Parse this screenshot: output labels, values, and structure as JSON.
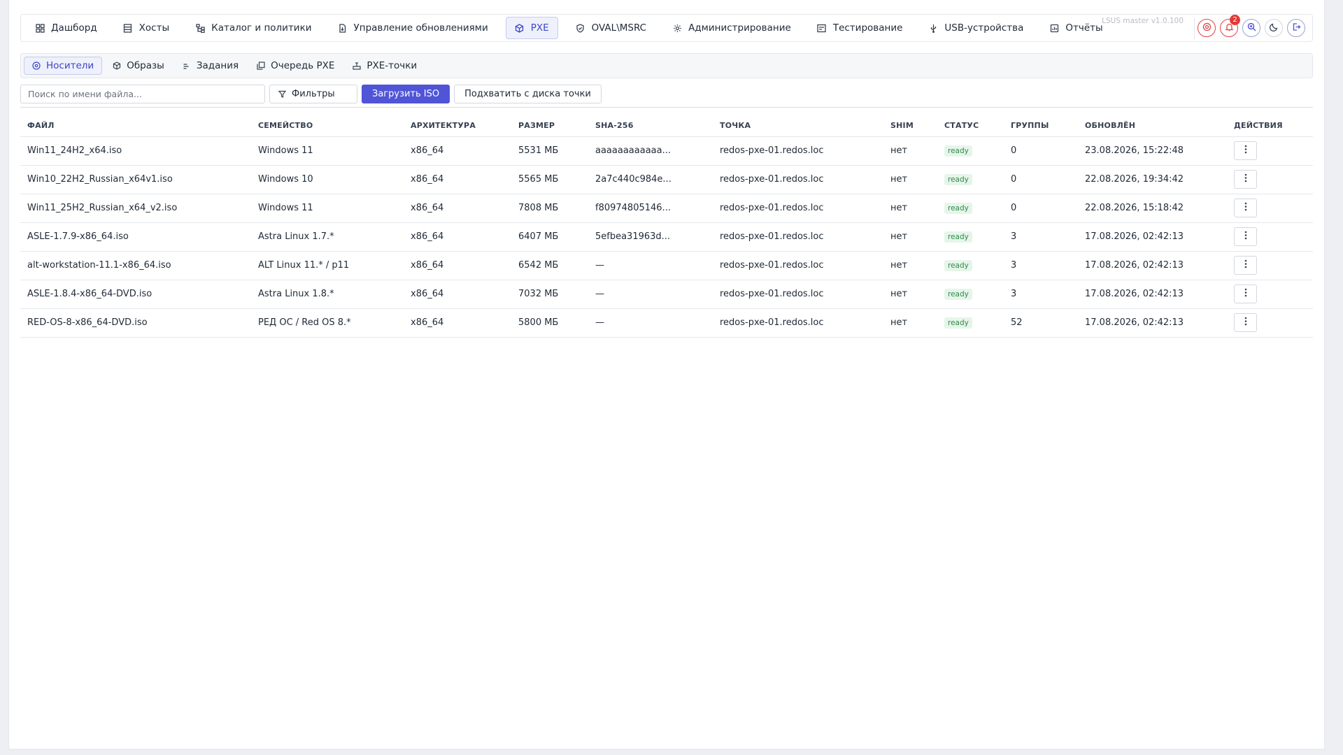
{
  "topnav": {
    "items": [
      {
        "label": "Дашборд",
        "icon": "dashboard-icon"
      },
      {
        "label": "Хосты",
        "icon": "server-icon"
      },
      {
        "label": "Каталог и политики",
        "icon": "hierarchy-icon"
      },
      {
        "label": "Управление обновлениями",
        "icon": "update-file-icon"
      },
      {
        "label": "PXE",
        "icon": "cube-icon"
      },
      {
        "label": "OVAL\\MSRC",
        "icon": "shield-check-icon"
      },
      {
        "label": "Администрирование",
        "icon": "gear-icon"
      },
      {
        "label": "Тестирование",
        "icon": "checklist-icon"
      },
      {
        "label": "USB-устройства",
        "icon": "usb-icon"
      },
      {
        "label": "Отчёты",
        "icon": "report-icon"
      }
    ],
    "active_index": 4,
    "version": "LSUS master v1.0.100",
    "notification_count": "2",
    "colors": {
      "accent": "#4f55d6",
      "alert": "#e04444"
    }
  },
  "subnav": {
    "items": [
      {
        "label": "Носители",
        "icon": "disc-icon"
      },
      {
        "label": "Образы",
        "icon": "cube-icon"
      },
      {
        "label": "Задания",
        "icon": "tasks-icon"
      },
      {
        "label": "Очередь PXE",
        "icon": "queue-icon"
      },
      {
        "label": "PXE-точки",
        "icon": "network-point-icon"
      }
    ],
    "active_index": 0
  },
  "toolbar": {
    "search_placeholder": "Поиск по имени файла...",
    "filter_label": "Фильтры",
    "upload_label": "Загрузить ISO",
    "pickup_label": "Подхватить с диска точки"
  },
  "table": {
    "columns": [
      "ФАЙЛ",
      "СЕМЕЙСТВО",
      "АРХИТЕКТУРА",
      "РАЗМЕР",
      "SHA-256",
      "ТОЧКА",
      "SHIM",
      "СТАТУС",
      "ГРУППЫ",
      "ОБНОВЛЁН",
      "ДЕЙСТВИЯ"
    ],
    "rows": [
      {
        "file": "Win11_24H2_x64.iso",
        "family": "Windows 11",
        "arch": "x86_64",
        "size": "5531 МБ",
        "sha": "aaaaaaaaaaaa...",
        "point": "redos-pxe-01.redos.loc",
        "shim": "нет",
        "status": "ready",
        "groups": "0",
        "updated": "23.08.2026, 15:22:48"
      },
      {
        "file": "Win10_22H2_Russian_x64v1.iso",
        "family": "Windows 10",
        "arch": "x86_64",
        "size": "5565 МБ",
        "sha": "2a7c440c984e...",
        "point": "redos-pxe-01.redos.loc",
        "shim": "нет",
        "status": "ready",
        "groups": "0",
        "updated": "22.08.2026, 19:34:42"
      },
      {
        "file": "Win11_25H2_Russian_x64_v2.iso",
        "family": "Windows 11",
        "arch": "x86_64",
        "size": "7808 МБ",
        "sha": "f80974805146...",
        "point": "redos-pxe-01.redos.loc",
        "shim": "нет",
        "status": "ready",
        "groups": "0",
        "updated": "22.08.2026, 15:18:42"
      },
      {
        "file": "ASLE-1.7.9-x86_64.iso",
        "family": "Astra Linux 1.7.*",
        "arch": "x86_64",
        "size": "6407 МБ",
        "sha": "5efbea31963d...",
        "point": "redos-pxe-01.redos.loc",
        "shim": "нет",
        "status": "ready",
        "groups": "3",
        "updated": "17.08.2026, 02:42:13"
      },
      {
        "file": "alt-workstation-11.1-x86_64.iso",
        "family": "ALT Linux 11.* / p11",
        "arch": "x86_64",
        "size": "6542 МБ",
        "sha": "—",
        "point": "redos-pxe-01.redos.loc",
        "shim": "нет",
        "status": "ready",
        "groups": "3",
        "updated": "17.08.2026, 02:42:13"
      },
      {
        "file": "ASLE-1.8.4-x86_64-DVD.iso",
        "family": "Astra Linux 1.8.*",
        "arch": "x86_64",
        "size": "7032 МБ",
        "sha": "—",
        "point": "redos-pxe-01.redos.loc",
        "shim": "нет",
        "status": "ready",
        "groups": "3",
        "updated": "17.08.2026, 02:42:13"
      },
      {
        "file": "RED-OS-8-x86_64-DVD.iso",
        "family": "РЕД ОС / Red OS 8.*",
        "arch": "x86_64",
        "size": "5800 МБ",
        "sha": "—",
        "point": "redos-pxe-01.redos.loc",
        "shim": "нет",
        "status": "ready",
        "groups": "52",
        "updated": "17.08.2026, 02:42:13"
      }
    ],
    "actions_icon": "kebab-menu-icon"
  }
}
